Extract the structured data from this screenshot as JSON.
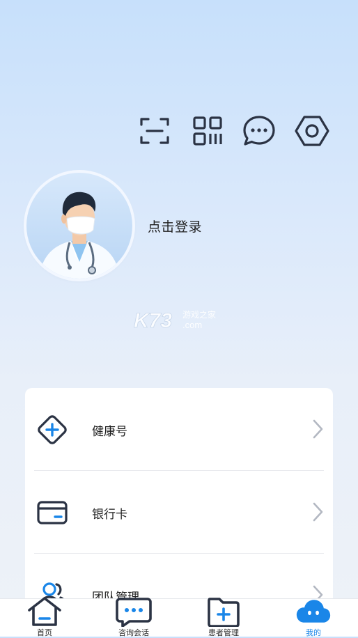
{
  "top_icons": [
    {
      "name": "scan-icon"
    },
    {
      "name": "qrcode-icon"
    },
    {
      "name": "message-icon"
    },
    {
      "name": "settings-icon"
    }
  ],
  "profile": {
    "avatar_icon": "doctor-avatar",
    "login_text": "点击登录"
  },
  "watermark": {
    "brand": "K73",
    "sub1": "游戏之家",
    "sub2": ".com"
  },
  "menu": [
    {
      "label": "健康号",
      "icon": "health-plus-icon"
    },
    {
      "label": "银行卡",
      "icon": "bank-card-icon"
    },
    {
      "label": "团队管理",
      "icon": "team-icon"
    }
  ],
  "tabbar": {
    "active_index": 3,
    "tabs": [
      {
        "label": "首页",
        "icon": "home-icon"
      },
      {
        "label": "咨询会话",
        "icon": "chat-icon"
      },
      {
        "label": "患者管理",
        "icon": "patient-folder-icon"
      },
      {
        "label": "我的",
        "icon": "profile-cloud-icon"
      }
    ]
  },
  "colors": {
    "accent": "#1a86e8",
    "icon_dark": "#2b3344",
    "gradient_top": "#c7e0fb",
    "card_bg": "#ffffff"
  }
}
